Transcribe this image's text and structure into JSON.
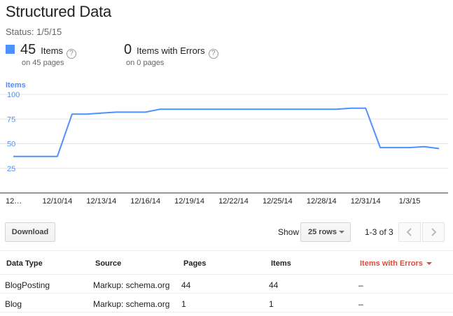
{
  "header": {
    "title": "Structured Data",
    "status": "Status: 1/5/15"
  },
  "stats": {
    "items": {
      "value": "45",
      "label": "Items",
      "sub": "on 45 pages",
      "color": "#4d90fe"
    },
    "errors": {
      "value": "0",
      "label": "Items with Errors",
      "sub": "on 0 pages"
    }
  },
  "chart_data": {
    "type": "line",
    "title": "Items",
    "x_labels": [
      "12…",
      "12/10/14",
      "12/13/14",
      "12/16/14",
      "12/19/14",
      "12/22/14",
      "12/25/14",
      "12/28/14",
      "12/31/14",
      "1/3/15"
    ],
    "x": [
      "12/7/14",
      "12/8/14",
      "12/9/14",
      "12/10/14",
      "12/11/14",
      "12/12/14",
      "12/13/14",
      "12/14/14",
      "12/15/14",
      "12/16/14",
      "12/17/14",
      "12/18/14",
      "12/19/14",
      "12/20/14",
      "12/21/14",
      "12/22/14",
      "12/23/14",
      "12/24/14",
      "12/25/14",
      "12/26/14",
      "12/27/14",
      "12/28/14",
      "12/29/14",
      "12/30/14",
      "12/31/14",
      "1/1/15",
      "1/2/15",
      "1/3/15",
      "1/4/15",
      "1/5/15"
    ],
    "series": [
      {
        "values": [
          37,
          37,
          37,
          37,
          80,
          80,
          81,
          82,
          82,
          82,
          85,
          85,
          85,
          85,
          85,
          85,
          85,
          85,
          85,
          85,
          85,
          85,
          85,
          86,
          86,
          46,
          46,
          46,
          47,
          45
        ],
        "color": "#4d90fe"
      }
    ],
    "y_ticks": [
      100,
      75,
      50,
      25
    ],
    "ylim": [
      0,
      100
    ],
    "grid": true
  },
  "controls": {
    "download_label": "Download",
    "show_label": "Show",
    "rows_value": "25 rows",
    "pager_text": "1-3 of 3"
  },
  "table": {
    "headers": [
      "Data Type",
      "Source",
      "Pages",
      "Items",
      "Items with Errors"
    ],
    "rows": [
      [
        "BlogPosting",
        "Markup: schema.org",
        "44",
        "44",
        "–"
      ],
      [
        "Blog",
        "Markup: schema.org",
        "1",
        "1",
        "–"
      ]
    ]
  }
}
